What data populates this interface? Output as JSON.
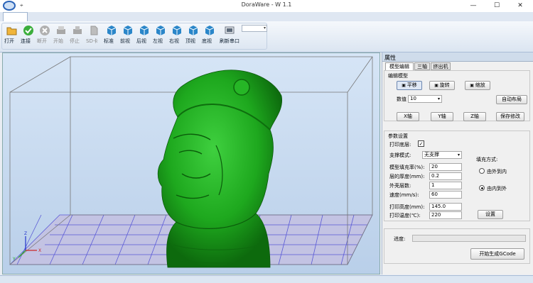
{
  "window": {
    "title": "DoraWare - W 1.1",
    "qat_icon": "pin-icon"
  },
  "window_buttons": {
    "minimize": "—",
    "maximize": "☐",
    "close": "✕"
  },
  "toolbar": {
    "items": [
      {
        "label": "打开",
        "icon": "folder-open-icon",
        "enabled": true
      },
      {
        "label": "连接",
        "icon": "check-icon",
        "enabled": true
      },
      {
        "label": "断开",
        "icon": "disconnect-icon",
        "enabled": false
      },
      {
        "label": "开始",
        "icon": "print-icon",
        "enabled": false
      },
      {
        "label": "停止",
        "icon": "stop-icon",
        "enabled": false
      },
      {
        "label": "SD卡",
        "icon": "sdcard-icon",
        "enabled": false
      },
      {
        "label": "标准",
        "icon": "cube-standard-icon",
        "enabled": true
      },
      {
        "label": "前视",
        "icon": "cube-front-icon",
        "enabled": true
      },
      {
        "label": "后视",
        "icon": "cube-back-icon",
        "enabled": true
      },
      {
        "label": "左视",
        "icon": "cube-left-icon",
        "enabled": true
      },
      {
        "label": "右视",
        "icon": "cube-right-icon",
        "enabled": true
      },
      {
        "label": "顶视",
        "icon": "cube-top-icon",
        "enabled": true
      },
      {
        "label": "底视",
        "icon": "cube-bottom-icon",
        "enabled": true
      },
      {
        "label": "刷新串口",
        "icon": "refresh-port-icon",
        "enabled": true
      }
    ],
    "port_combo_value": ""
  },
  "panel": {
    "title": "属性",
    "tabs": [
      {
        "label": "模型编辑",
        "active": true
      },
      {
        "label": "三轴",
        "active": false
      },
      {
        "label": "挤出机",
        "active": false
      }
    ],
    "edit_model": {
      "group_title": "编辑模型",
      "mode_buttons": [
        "平移",
        "旋转",
        "缩放"
      ],
      "value_label": "数值",
      "value": "10",
      "auto_layout": "自动布局",
      "axis_buttons": [
        "X轴",
        "Y轴",
        "Z轴"
      ],
      "save_changes": "保存修改"
    },
    "params": {
      "group_title": "参数设置",
      "print_base_label": "打印底层:",
      "print_base_checked": true,
      "support_label": "支撑模式:",
      "support_value": "无支撑",
      "fill_label": "模型填充率(%):",
      "fill_value": "20",
      "layer_label": "层的厚度(mm):",
      "layer_value": "0.2",
      "shell_label": "外壳层数:",
      "shell_value": "1",
      "speed_label": "速度(mm/s):",
      "speed_value": "60",
      "fill_mode_label": "填充方式:",
      "fill_modes": [
        {
          "label": "由外到内",
          "selected": false
        },
        {
          "label": "由内到外",
          "selected": true
        }
      ],
      "height_label": "打印高度(mm):",
      "height_value": "145.0",
      "temp_label": "打印温度(℃):",
      "temp_value": "220",
      "settings_button": "设置"
    },
    "progress_label": "进度:",
    "progress_value": 0,
    "generate_button": "开始生成GCode"
  },
  "viewport": {
    "axes": [
      "X",
      "Y",
      "Z"
    ],
    "model_color": "#1fa71f",
    "grid_color": "#5a5ad6",
    "bg_color": "#c8dcf2"
  }
}
